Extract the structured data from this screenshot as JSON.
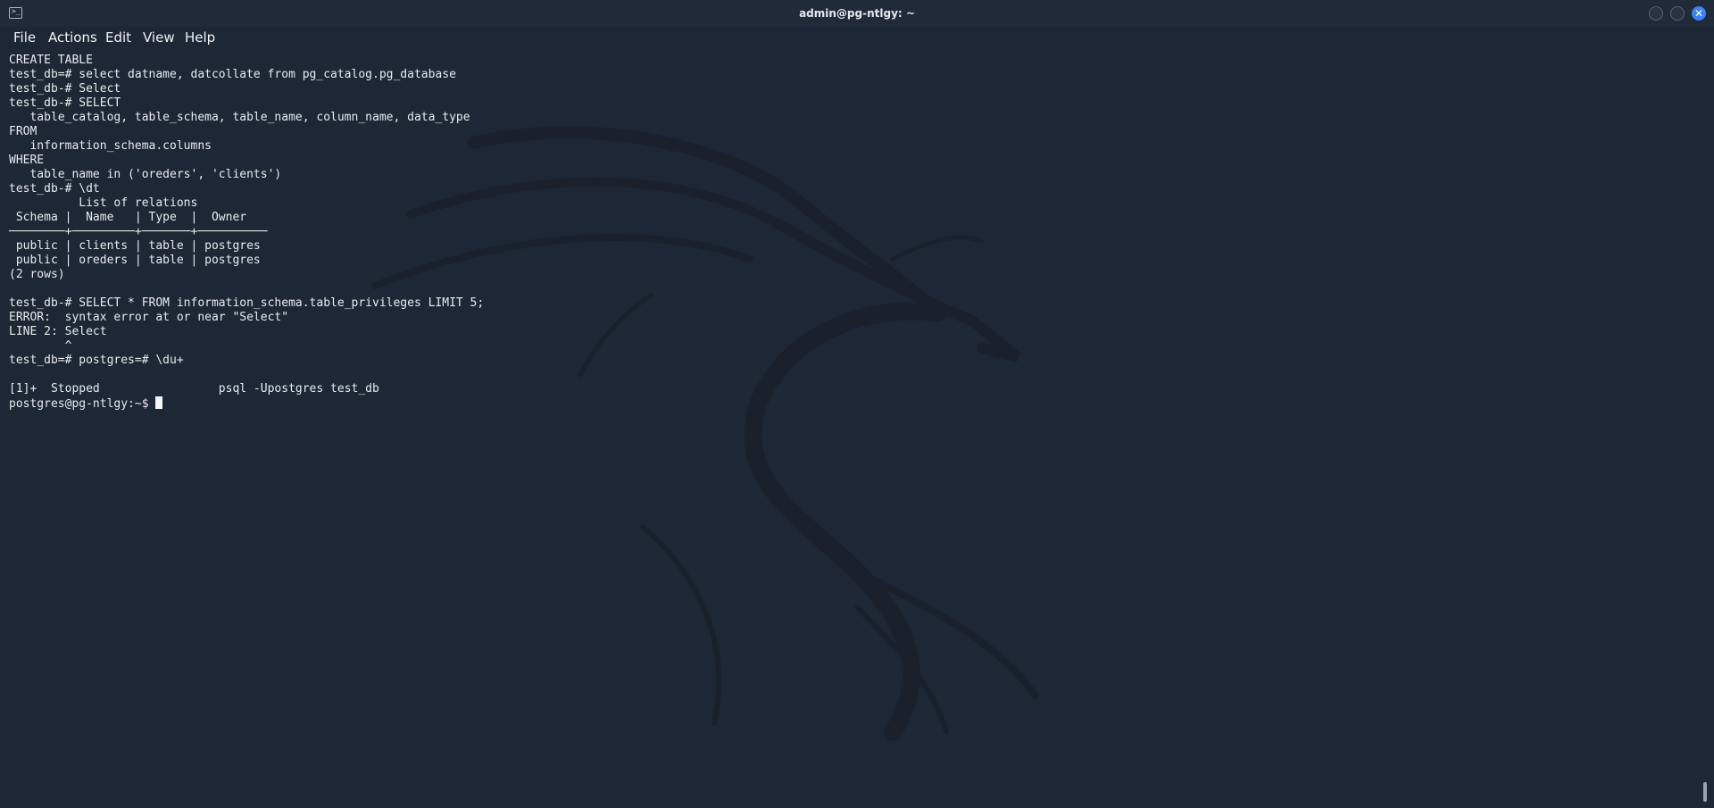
{
  "window": {
    "title": "admin@pg-ntlgy: ~",
    "app_icon_glyph": ">_",
    "close_glyph": "✕"
  },
  "menu": {
    "file": "File",
    "actions": "Actions",
    "edit": "Edit",
    "view": "View",
    "help": "Help"
  },
  "terminal": {
    "lines": [
      "CREATE TABLE",
      "test_db=# select datname, datcollate from pg_catalog.pg_database",
      "test_db-# Select",
      "test_db-# SELECT",
      "   table_catalog, table_schema, table_name, column_name, data_type",
      "FROM",
      "   information_schema.columns",
      "WHERE",
      "   table_name in ('oreders', 'clients')",
      "test_db-# \\dt",
      "          List of relations",
      " Schema |  Name   | Type  |  Owner",
      "────────+─────────+───────+──────────",
      " public | clients | table | postgres",
      " public | oreders | table | postgres",
      "(2 rows)",
      "",
      "test_db-# SELECT * FROM information_schema.table_privileges LIMIT 5;",
      "ERROR:  syntax error at or near \"Select\"",
      "LINE 2: Select",
      "        ^",
      "test_db=# postgres=# \\du+",
      "",
      "[1]+  Stopped                 psql -Upostgres test_db"
    ],
    "prompt": "postgres@pg-ntlgy:~$ "
  },
  "colors": {
    "background": "#1e2735",
    "text": "#e8ebef",
    "close_button": "#3b82f6"
  }
}
